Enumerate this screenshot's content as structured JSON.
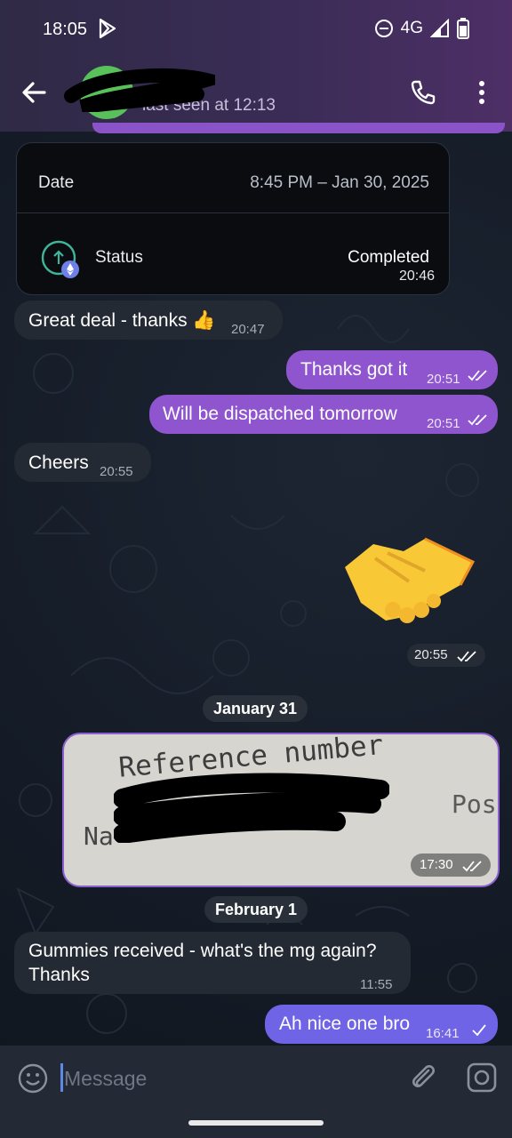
{
  "status_bar": {
    "time": "18:05",
    "network": "4G"
  },
  "header": {
    "last_seen": "last seen at 12:13"
  },
  "transaction_card": {
    "date_label": "Date",
    "date_value": "8:45 PM – Jan 30, 2025",
    "status_label": "Status",
    "status_value": "Completed",
    "time": "20:46"
  },
  "messages": [
    {
      "id": "m1",
      "text": "Great deal - thanks 👍",
      "time": "20:47",
      "direction": "in"
    },
    {
      "id": "m2",
      "text": "Thanks got it",
      "time": "20:51",
      "direction": "out",
      "read": true
    },
    {
      "id": "m3",
      "text": "Will be dispatched tomorrow",
      "time": "20:51",
      "direction": "out",
      "read": true
    },
    {
      "id": "m4",
      "text": "Cheers",
      "time": "20:55",
      "direction": "in"
    },
    {
      "id": "m5",
      "emoji": "handshake",
      "time": "20:55",
      "direction": "out",
      "read": true
    },
    {
      "id": "m6",
      "photo_text_line1": "Reference number",
      "photo_text_left": "Na",
      "photo_text_right": "Pos",
      "time": "17:30",
      "direction": "out",
      "read": true
    },
    {
      "id": "m7",
      "text_line1": "Gummies received - what's the mg again?",
      "text_line2": "Thanks",
      "time": "11:55",
      "direction": "in"
    },
    {
      "id": "m8",
      "text": "Ah nice one bro",
      "time": "16:41",
      "direction": "out",
      "read": false
    }
  ],
  "date_separators": {
    "first": "January 31",
    "second": "February 1"
  },
  "composer": {
    "placeholder": "Message"
  },
  "colors": {
    "outgoing": "#8f55cf",
    "incoming": "#242a33",
    "header": "#3a2c56"
  }
}
